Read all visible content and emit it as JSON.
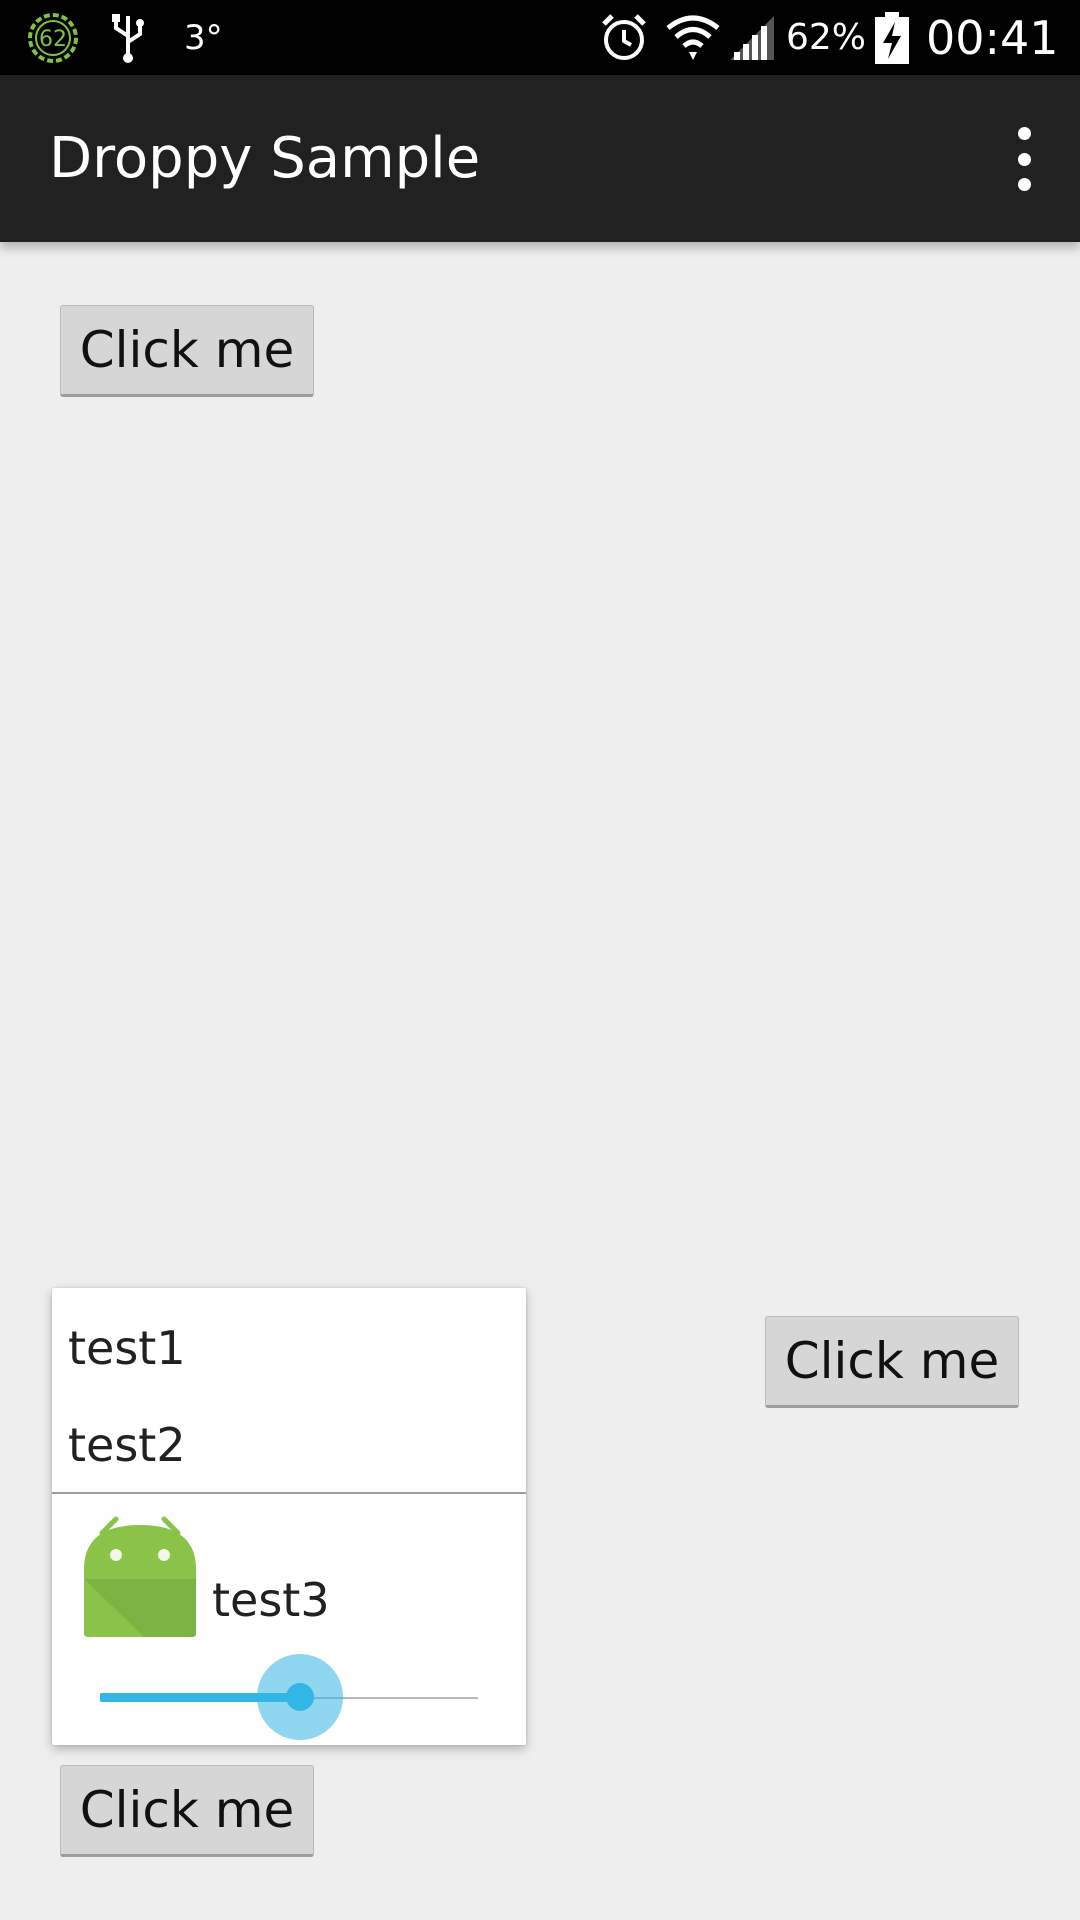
{
  "status_bar": {
    "notification_badge": "62",
    "temperature": "3°",
    "battery_percent": "62%",
    "time": "00:41",
    "icons": [
      "battery-ring-icon",
      "usb-icon",
      "temperature-icon",
      "alarm-icon",
      "wifi-icon",
      "signal-icon",
      "battery-charging-icon"
    ]
  },
  "app_bar": {
    "title": "Droppy Sample",
    "overflow_icon": "more-vert-icon"
  },
  "buttons": {
    "top_label": "Click me",
    "right_label": "Click me",
    "bottom_label": "Click me"
  },
  "dropdown": {
    "items": [
      {
        "label": "test1"
      },
      {
        "label": "test2"
      },
      {
        "label": "test3",
        "icon": "android-robot-icon"
      }
    ],
    "slider_value": 0.53
  },
  "colors": {
    "app_bar": "#212121",
    "background": "#eeeeee",
    "accent": "#33b5e5",
    "android_green": "#8bc34a"
  }
}
